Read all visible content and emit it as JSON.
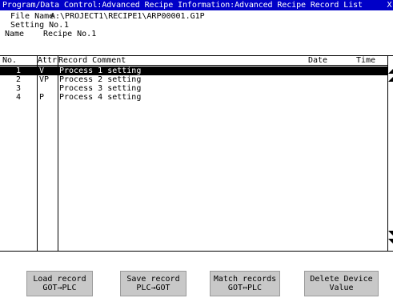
{
  "window": {
    "title": "Program/Data Control:Advanced Recipe Information:Advanced Recipe Record List",
    "close_glyph": "X"
  },
  "info": {
    "file_name_label": "File Name",
    "file_name_value": "A:\\PROJECT1\\RECIPE1\\ARP00001.G1P",
    "setting_no_label": "Setting No.",
    "setting_no_value": "1",
    "name_label": "Name",
    "name_value": "Recipe No.1"
  },
  "table": {
    "columns": {
      "no": "No.",
      "attr": "Attr",
      "comment": "Record Comment",
      "date": "Date",
      "time": "Time"
    },
    "rows": [
      {
        "no": "1",
        "attr": "V",
        "comment": "Process 1 setting",
        "date": "",
        "time": "",
        "selected": true
      },
      {
        "no": "2",
        "attr": "VP",
        "comment": "Process 2 setting",
        "date": "",
        "time": "",
        "selected": false
      },
      {
        "no": "3",
        "attr": "",
        "comment": "Process 3 setting",
        "date": "",
        "time": "",
        "selected": false
      },
      {
        "no": "4",
        "attr": "P",
        "comment": "Process 4 setting",
        "date": "",
        "time": "",
        "selected": false
      }
    ]
  },
  "scrollbar": {
    "up_icon": "scroll-up-icon",
    "down_icon": "scroll-down-icon"
  },
  "buttons": {
    "load": {
      "line1": "Load record",
      "line2": "GOT→PLC"
    },
    "save": {
      "line1": "Save record",
      "line2": "PLC→GOT"
    },
    "match": {
      "line1": "Match records",
      "line2": "GOT⇔PLC"
    },
    "delete": {
      "line1": "Delete Device",
      "line2": "Value"
    }
  },
  "colors": {
    "title_bg": "#0000c8",
    "title_fg": "#ffffff",
    "selected_row_bg": "#000000",
    "button_bg": "#c8c8c8"
  }
}
